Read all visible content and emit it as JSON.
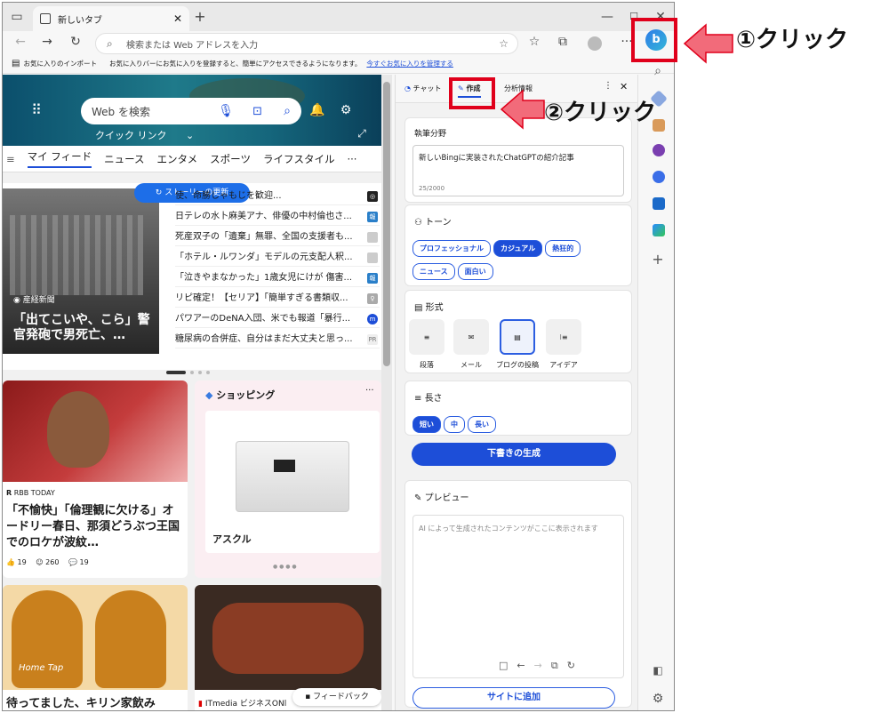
{
  "browser": {
    "tab_title": "新しいタブ",
    "address_placeholder": "検索または Web アドレスを入力",
    "favbar_import": "お気に入りのインポート",
    "favbar_message": "お気に入りバーにお気に入りを登録すると、簡単にアクセスできるようになります。",
    "favbar_link": "今すぐお気に入りを管理する"
  },
  "feed": {
    "search_placeholder": "Web を検索",
    "quick_links": "クイック リンク",
    "nav": [
      "マイ フィード",
      "ニュース",
      "エンタメ",
      "スポーツ",
      "ライフスタイル",
      "···"
    ],
    "story_update": "ストーリーの更新",
    "main_source": "産経新聞",
    "main_title": "「出てこいや、こら」警官発砲で男死亡、…",
    "headlines": [
      "使、命勝しゃもじを歓迎...",
      "日テレの水卜麻美アナ、俳優の中村倫也さ...",
      "死産双子の「遺棄」無罪、全国の支援者も...",
      "「ホテル・ルワンダ」モデルの元支配人釈...",
      "「泣きやまなかった」1歳女児にけが 傷害...",
      "リピ確定！【セリア】「簡単すぎる書類収...",
      "パワアーのDeNA入団、米でも報道「暴行...",
      "糖尿病の合併症、自分はまだ大丈夫と思っ..."
    ],
    "card1_source": "RBB TODAY",
    "card1_title": "「不愉快」「倫理観に欠ける」オードリー春日、那須どうぶつ王国でのロケが波紋…",
    "card1_stats": [
      "19",
      "260",
      "19"
    ],
    "shopping_label": "ショッピング",
    "shopping_item": "アスクル",
    "bottom_left_title": "待ってました、キリン家飲み",
    "bottom_left_brand": "Home Tap",
    "bottom_right_source": "ITmedia ビジネスONl",
    "feedback": "フィードバック"
  },
  "pane": {
    "tabs": [
      "チャット",
      "作成",
      "分析情報"
    ],
    "topic_label": "執筆分野",
    "topic_value": "新しいBingに実装されたChatGPTの紹介記事",
    "char_count": "25/2000",
    "tone_label": "トーン",
    "tones": [
      "プロフェッショナル",
      "カジュアル",
      "熱狂的",
      "ニュース",
      "面白い"
    ],
    "tone_selected": "カジュアル",
    "format_label": "形式",
    "formats": [
      "段落",
      "メール",
      "ブログの投稿",
      "アイデア"
    ],
    "format_selected": "ブログの投稿",
    "length_label": "長さ",
    "lengths": [
      "短い",
      "中",
      "長い"
    ],
    "length_selected": "短い",
    "generate_button": "下書きの生成",
    "preview_label": "プレビュー",
    "preview_placeholder": "AI によって生成されたコンテンツがここに表示されます",
    "add_site_button": "サイトに追加"
  },
  "annotations": {
    "step1": "①クリック",
    "step2": "②クリック"
  },
  "colors": {
    "accent": "#1d4ed8",
    "annotation_red": "#e0001b",
    "arrow_pink": "#f26b7a"
  }
}
